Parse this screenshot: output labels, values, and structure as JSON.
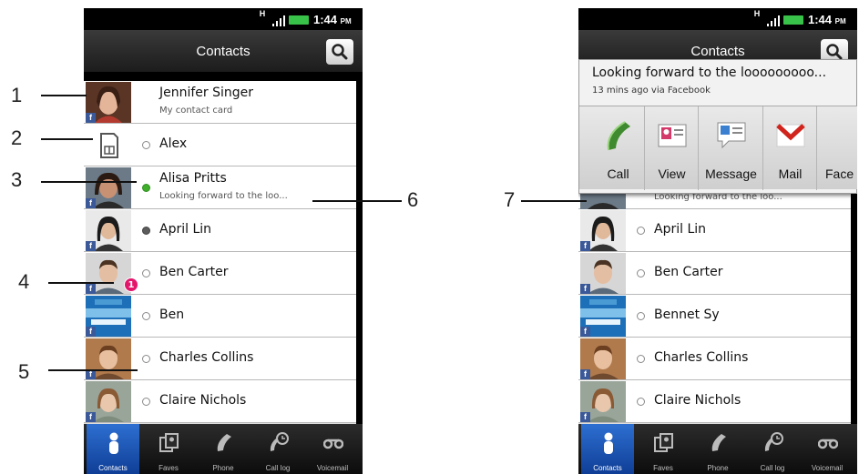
{
  "status_bar": {
    "network": "H",
    "time": "1:44",
    "ampm": "PM"
  },
  "title_bar": {
    "title": "Contacts"
  },
  "left_phone": {
    "contacts": [
      {
        "name": "Jennifer Singer",
        "subtitle": "My contact card",
        "presence": "none",
        "facebook": true
      },
      {
        "name": "Alex",
        "subtitle": "",
        "presence": "offline",
        "facebook": false
      },
      {
        "name": "Alisa Pritts",
        "subtitle": "Looking forward to the loo...",
        "presence": "online",
        "facebook": true
      },
      {
        "name": "April Lin",
        "subtitle": "",
        "presence": "idle",
        "facebook": true
      },
      {
        "name": "Ben Carter",
        "subtitle": "",
        "presence": "offline",
        "facebook": true,
        "badge": "1"
      },
      {
        "name": "Ben",
        "subtitle": "",
        "presence": "offline",
        "facebook": true
      },
      {
        "name": "Charles Collins",
        "subtitle": "",
        "presence": "offline",
        "facebook": true
      },
      {
        "name": "Claire Nichols",
        "subtitle": "",
        "presence": "offline",
        "facebook": true
      }
    ]
  },
  "right_phone": {
    "popup": {
      "status": "Looking forward to the looooooooo...",
      "meta": "13 mins ago via Facebook",
      "actions": [
        "Call",
        "View",
        "Message",
        "Mail",
        "Face"
      ]
    },
    "contacts": [
      {
        "name": "",
        "subtitle": "Looking forward to the loo...",
        "presence": "none",
        "facebook": false
      },
      {
        "name": "April Lin",
        "subtitle": "",
        "presence": "offline",
        "facebook": true
      },
      {
        "name": "Ben Carter",
        "subtitle": "",
        "presence": "offline",
        "facebook": true
      },
      {
        "name": "Bennet Sy",
        "subtitle": "",
        "presence": "offline",
        "facebook": true
      },
      {
        "name": "Charles Collins",
        "subtitle": "",
        "presence": "offline",
        "facebook": true
      },
      {
        "name": "Claire Nichols",
        "subtitle": "",
        "presence": "offline",
        "facebook": true
      }
    ]
  },
  "tabs": [
    "Contacts",
    "Faves",
    "Phone",
    "Call log",
    "Voicemail"
  ],
  "callouts": [
    "1",
    "2",
    "3",
    "4",
    "5",
    "6",
    "7"
  ],
  "colors": {
    "online": "#3fae2a",
    "badge": "#e3166c",
    "tab_active": "#1f5fc4",
    "facebook": "#3b5998"
  },
  "icons": {
    "contacts_tab": "person-icon",
    "faves_tab": "faves-icon",
    "phone_tab": "phone-icon",
    "call_log_tab": "call-log-icon",
    "voicemail_tab": "voicemail-icon",
    "search": "search-icon",
    "sim": "sim-card-icon"
  }
}
